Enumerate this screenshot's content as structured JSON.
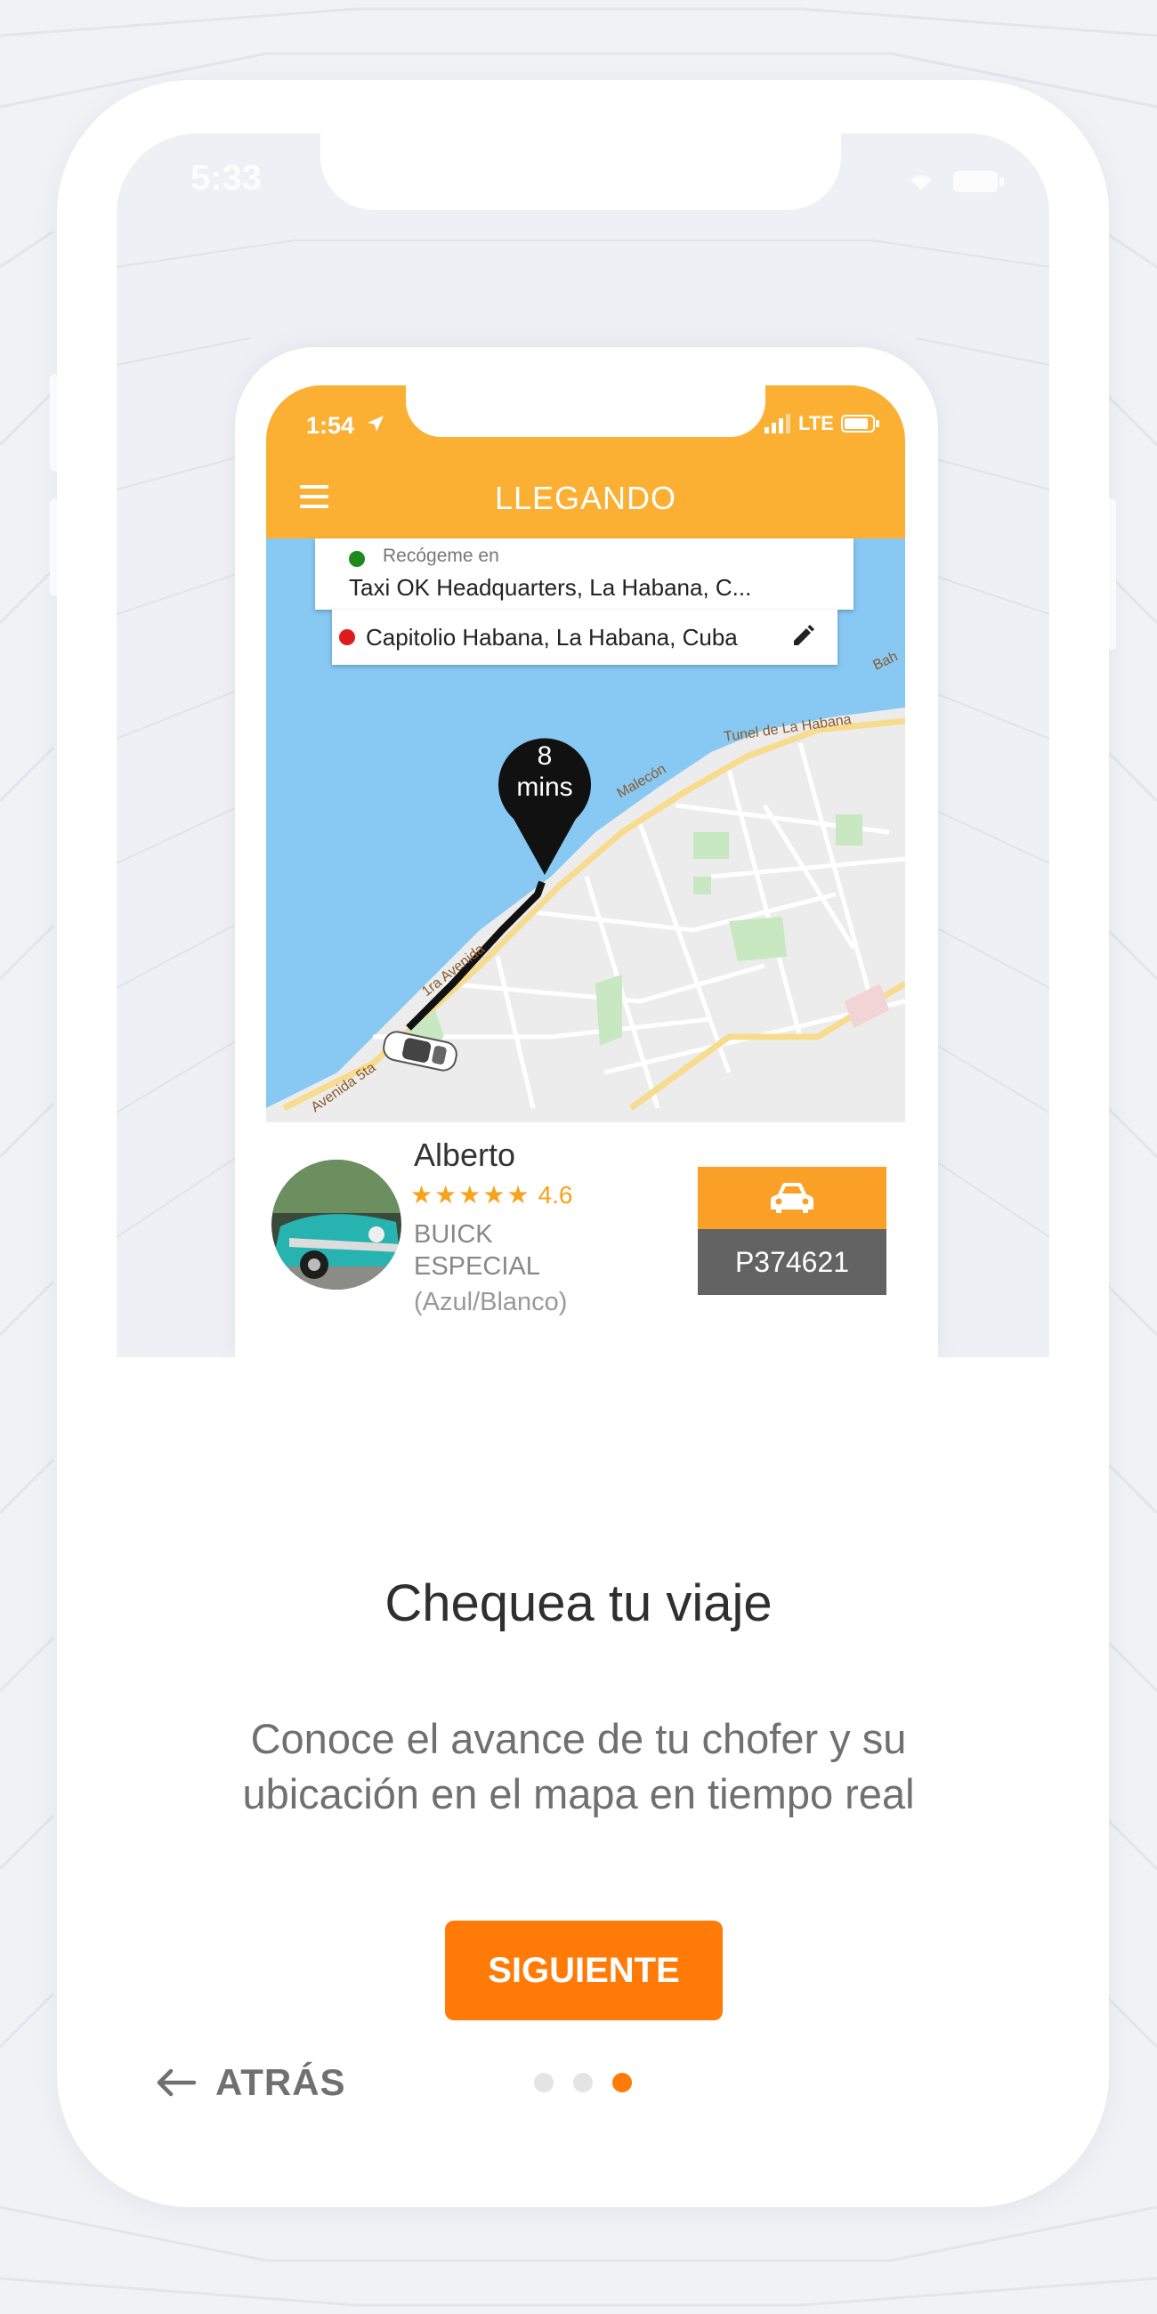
{
  "outer_status": {
    "time": "5:33"
  },
  "app": {
    "status_time": "1:54",
    "network": "LTE",
    "header_title": "LLEGANDO"
  },
  "trip": {
    "pickup_label": "Recógeme en",
    "pickup_address": "Taxi OK Headquarters,  La Habana,  C...",
    "destination": "Capitolio Habana, La Habana, Cuba",
    "eta_value": "8",
    "eta_unit": "mins"
  },
  "map_labels": {
    "tunel": "Tunel de La Habana",
    "malecon": "Malecón",
    "avenida_5ta": "Avenida 5ta",
    "avenida_1ra": "1ra Avenida",
    "bahia": "Bah"
  },
  "driver": {
    "name": "Alberto",
    "rating": "4.6",
    "stars": 5,
    "car_model_line1": "BUICK",
    "car_model_line2": "ESPECIAL",
    "car_color": "(Azul/Blanco)",
    "plate": "P374621"
  },
  "onboarding": {
    "title": "Chequea tu viaje",
    "description_line1": "Conoce el avance de tu chofer y su",
    "description_line2": "ubicación en el mapa en tiempo real",
    "next_label": "SIGUIENTE",
    "back_label": "ATRÁS",
    "page_count": 3,
    "current_page": 3
  },
  "colors": {
    "header": "#fbb034",
    "accent": "#ff7a06",
    "plate_top": "#fba026",
    "plate_bottom": "#636363",
    "water": "#87c9f3",
    "land": "#ececec"
  },
  "icons": {
    "menu": "hamburger-icon",
    "edit": "pencil-icon",
    "car": "car-icon",
    "back": "arrow-left-icon",
    "pin": "map-pin-icon",
    "star": "star-icon"
  }
}
